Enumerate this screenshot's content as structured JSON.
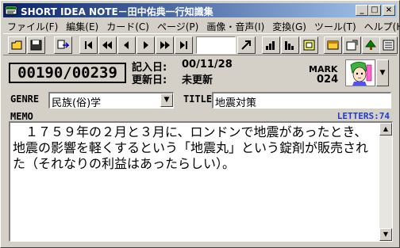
{
  "window": {
    "title": "SHORT IDEA NOTE－田中佑典一行知識集",
    "minimize_glyph": "_",
    "maximize_glyph": "□",
    "close_glyph": "×"
  },
  "menu": [
    "ファイル(F)",
    "編集(E)",
    "カード(C)",
    "ページ(P)",
    "画像・音声(I)",
    "変換(G)",
    "ツール(T)",
    "ヘルプ(H)"
  ],
  "toolbar": {
    "icons": [
      "open-folder-icon",
      "save-icon",
      "export-icon",
      "first-card-icon",
      "rewind-icon",
      "prev-card-icon",
      "next-card-icon",
      "fast-forward-icon",
      "last-card-icon",
      "jump-icon",
      "sort-asc-icon",
      "sort-desc-icon",
      "frame-icon",
      "window-icon",
      "card-edit-icon",
      "tree-icon",
      "list-view-icon"
    ],
    "jump_value": ""
  },
  "card": {
    "counter": "00190/00239",
    "entry_date_label": "記入日:",
    "entry_date": "00/11/28",
    "update_date_label": "更新日:",
    "update_date": "未更新",
    "mark_label": "MARK",
    "mark_value": "024"
  },
  "fields": {
    "genre_label": "GENRE",
    "genre_value": "民族(俗)学",
    "title_label": "TITLE",
    "title_value": "地震対策",
    "memo_label": "MEMO",
    "letters_label": "LETTERS:74",
    "memo_text": "　１７５９年の２月と３月に、ロンドンで地震があったとき、地震の影響を軽くするという「地震丸」という錠剤が販売された（それなりの利益はあったらしい）。"
  }
}
